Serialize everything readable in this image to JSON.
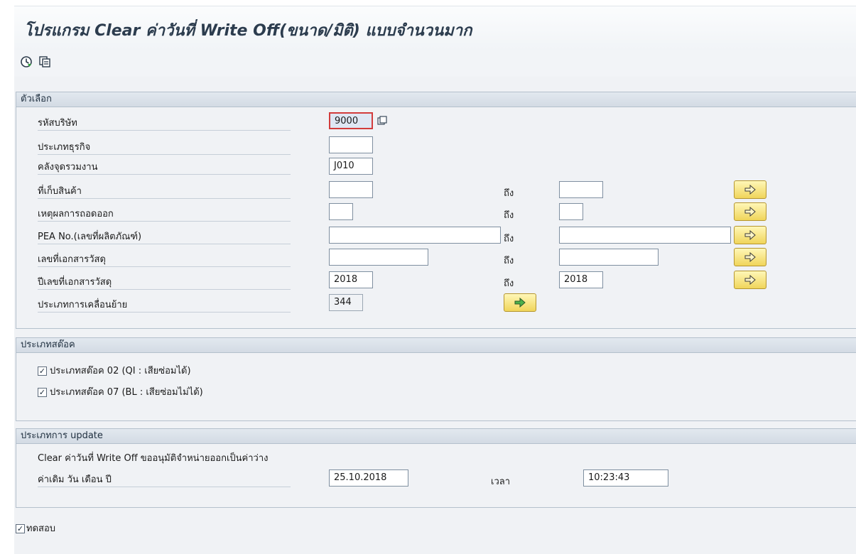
{
  "header": {
    "title": "โปรแกรม Clear ค่าวันที่ Write Off(ขนาด/มิติ) แบบจำนวนมาก"
  },
  "toolbar": {
    "icons": [
      "execute-icon",
      "get-variant-icon"
    ]
  },
  "selection": {
    "header": "ตัวเลือก",
    "to_label": "ถึง",
    "rows": [
      {
        "label": "รหัสบริษัท",
        "from": "9000"
      },
      {
        "label": "ประเภทธุรกิจ",
        "from": ""
      },
      {
        "label": "คลังจุดรวมงาน",
        "from": "J010"
      },
      {
        "label": "ที่เก็บสินค้า",
        "from": "",
        "to": ""
      },
      {
        "label": "เหตุผลการถอดออก",
        "from": "",
        "to": ""
      },
      {
        "label": "PEA No.(เลขที่ผลิตภัณฑ์)",
        "from": "",
        "to": ""
      },
      {
        "label": "เลขที่เอกสารวัสดุ",
        "from": "",
        "to": ""
      },
      {
        "label": "ปีเลขที่เอกสารวัสดุ",
        "from": "2018",
        "to": "2018"
      },
      {
        "label": "ประเภทการเคลื่อนย้าย",
        "from": "344"
      }
    ]
  },
  "stock_type": {
    "header": "ประเภทสต๊อค",
    "options": [
      {
        "label": "ประเภทสต๊อค 02 (QI : เสียซ่อมได้)",
        "checked": true
      },
      {
        "label": "ประเภทสต๊อค 07 (BL : เสียซ่อมไม่ได้)",
        "checked": true
      }
    ]
  },
  "update_type": {
    "header": "ประเภทการ update",
    "description": "Clear ค่าวันที่ Write Off ขออนุมัติจำหน่ายออกเป็นค่าว่าง",
    "date_label": "ค่าเดิม วัน เดือน ปี",
    "date_value": "25.10.2018",
    "time_label": "เวลา",
    "time_value": "10:23:43"
  },
  "test_run": {
    "label": "ทดสอบ",
    "checked": true
  },
  "colors": {
    "title": "#2c3c4e",
    "button_yellow": "#f0d55a",
    "focus_border": "#d23c3c"
  }
}
